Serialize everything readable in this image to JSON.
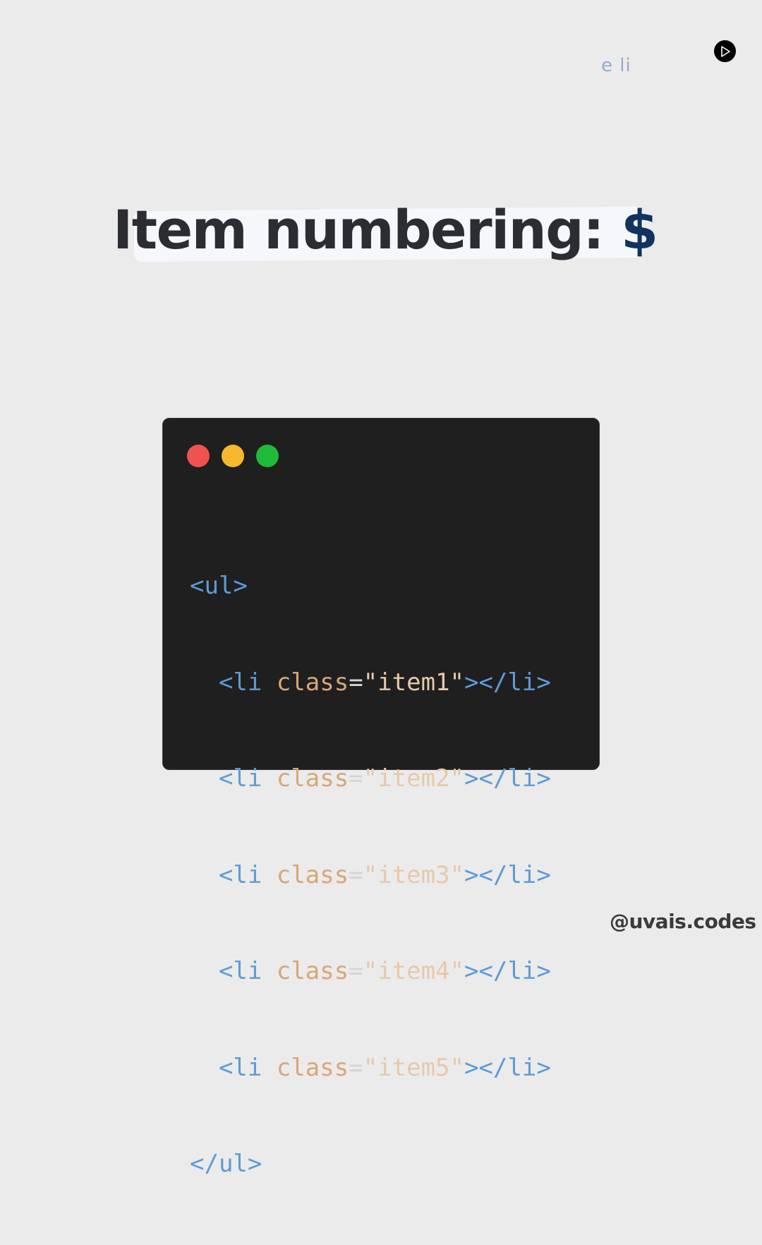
{
  "faint_text": "e li",
  "headline": {
    "text": "Item numbering:",
    "symbol": "$"
  },
  "code_window": {
    "lines": [
      {
        "indent": "",
        "open": "<ul>"
      },
      {
        "indent": "  ",
        "open": "<li ",
        "attr": "class",
        "eq": "=",
        "value": "\"item1\"",
        "close": "></li>"
      },
      {
        "indent": "  ",
        "open": "<li ",
        "attr": "class",
        "eq": "=",
        "value": "\"item2\"",
        "close": "></li>"
      },
      {
        "indent": "  ",
        "open": "<li ",
        "attr": "class",
        "eq": "=",
        "value": "\"item3\"",
        "close": "></li>"
      },
      {
        "indent": "  ",
        "open": "<li ",
        "attr": "class",
        "eq": "=",
        "value": "\"item4\"",
        "close": "></li>"
      },
      {
        "indent": "  ",
        "open": "<li ",
        "attr": "class",
        "eq": "=",
        "value": "\"item5\"",
        "close": "></li>"
      },
      {
        "indent": "",
        "open": "</ul>"
      }
    ],
    "colors": {
      "tag": "#5d9bd6",
      "attr": "#d9a677",
      "string": "#e7c9a9",
      "background": "#1f1f1f"
    },
    "window_buttons": [
      "red-dot",
      "yellow-dot",
      "green-dot"
    ]
  },
  "icons": {
    "play": "play-icon"
  },
  "handle": "@uvais.codes"
}
